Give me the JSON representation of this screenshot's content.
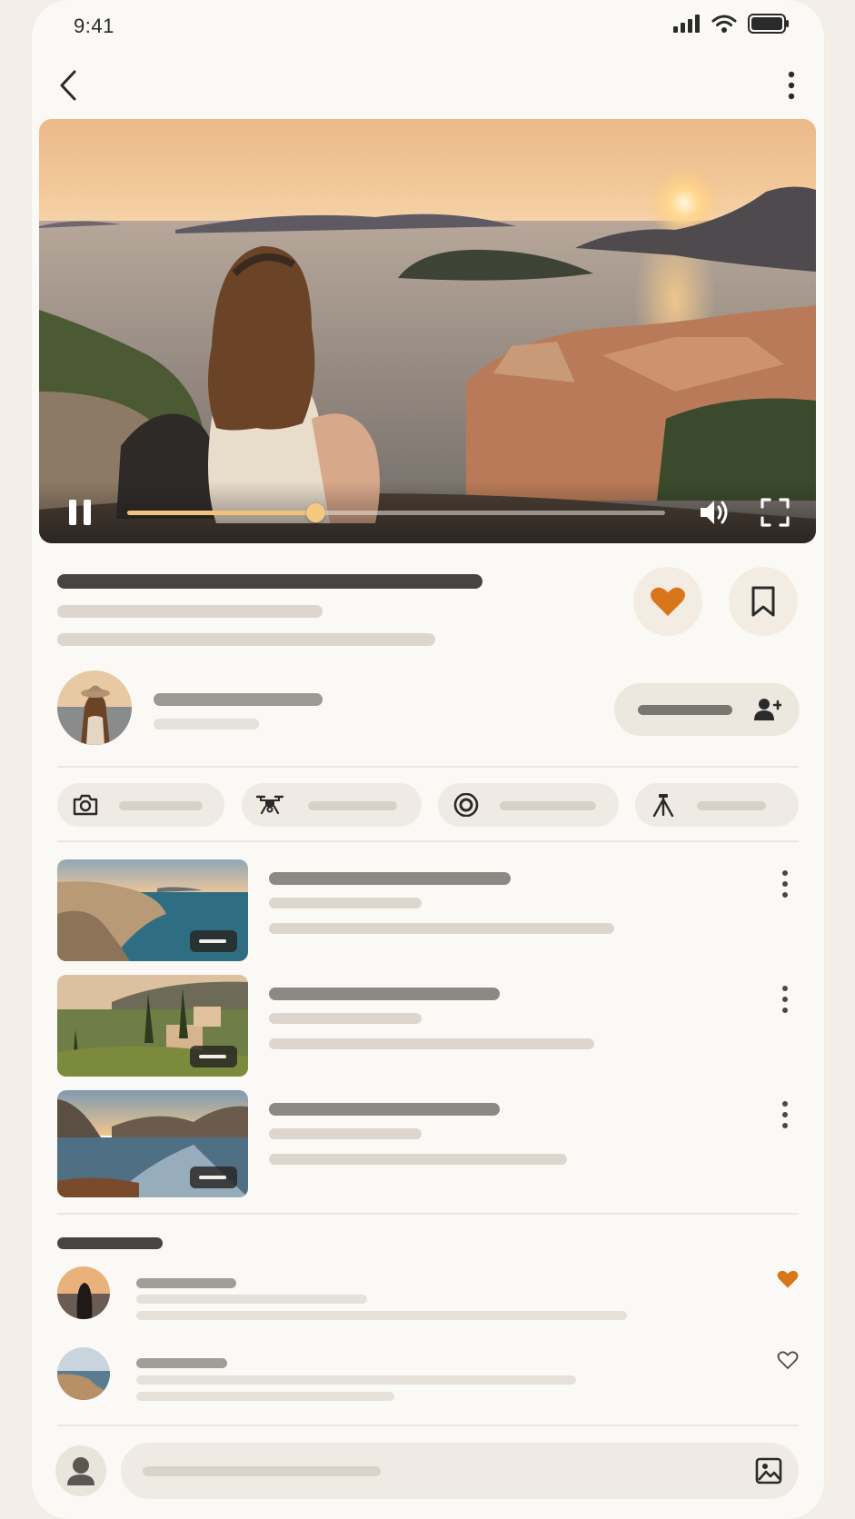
{
  "status_bar": {
    "time": "9:41"
  },
  "icons": {
    "back": "chevron-left-icon",
    "more": "more-vertical-icon",
    "pause": "pause-icon",
    "volume": "volume-icon",
    "fullscreen": "fullscreen-icon",
    "like": "heart-icon",
    "bookmark": "bookmark-icon",
    "follow": "add-user-icon",
    "camera": "camera-icon",
    "drone": "drone-icon",
    "lens": "lens-icon",
    "tripod": "tripod-icon",
    "image": "image-icon",
    "user": "user-icon"
  },
  "video": {
    "progress": 0.35
  },
  "colors": {
    "accent": "#d9761c",
    "background": "#fbf9f5"
  },
  "comments": [
    {
      "liked": true
    },
    {
      "liked": false
    }
  ]
}
